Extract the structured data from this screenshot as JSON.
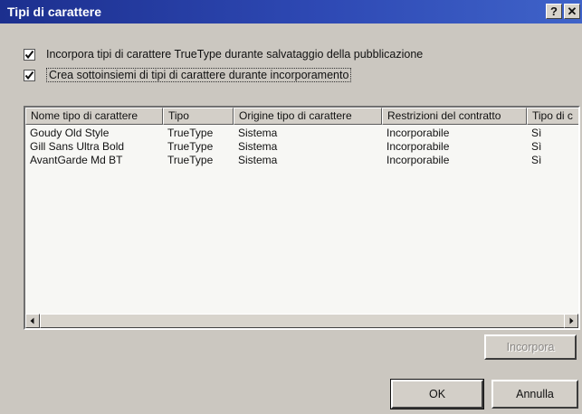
{
  "window": {
    "title": "Tipi di carattere",
    "help_button": "?",
    "close_button": "✕"
  },
  "options": [
    {
      "label": "Incorpora tipi di carattere TrueType durante salvataggio della pubblicazione",
      "checked": true
    },
    {
      "label": "Crea sottoinsiemi di tipi di carattere durante incorporamento",
      "checked": true
    }
  ],
  "table": {
    "columns": [
      "Nome tipo di carattere",
      "Tipo",
      "Origine tipo di carattere",
      "Restrizioni del contratto",
      "Tipo di c"
    ],
    "rows": [
      [
        "Goudy Old Style",
        "TrueType",
        "Sistema",
        "Incorporabile",
        "Sì"
      ],
      [
        "Gill Sans Ultra Bold",
        "TrueType",
        "Sistema",
        "Incorporabile",
        "Sì"
      ],
      [
        "AvantGarde Md BT",
        "TrueType",
        "Sistema",
        "Incorporabile",
        "Sì"
      ]
    ]
  },
  "buttons": {
    "embed": "Incorpora",
    "ok": "OK",
    "cancel": "Annulla"
  }
}
